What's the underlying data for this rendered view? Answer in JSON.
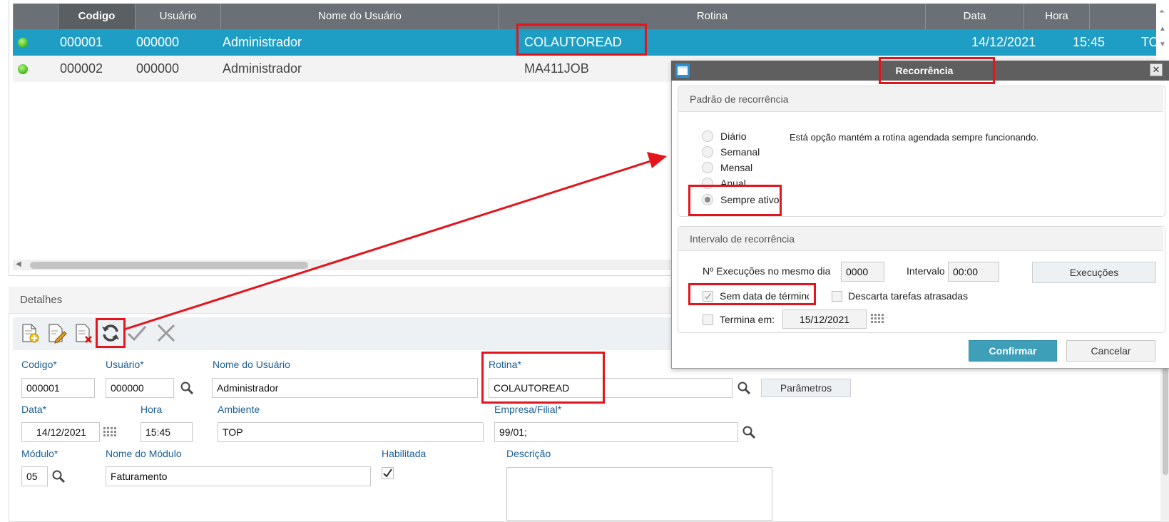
{
  "grid": {
    "columns": [
      "",
      "Codigo",
      "Usuário",
      "Nome do Usuário",
      "Rotina",
      "Data",
      "Hora",
      ""
    ],
    "rows": [
      {
        "codigo": "000001",
        "usuario": "000000",
        "nome": "Administrador",
        "rotina": "COLAUTOREAD",
        "data": "14/12/2021",
        "hora": "15:45",
        "extra": "TO"
      },
      {
        "codigo": "000002",
        "usuario": "000000",
        "nome": "Administrador",
        "rotina": "MA411JOB",
        "data": "",
        "hora": "",
        "extra": ""
      }
    ]
  },
  "details": {
    "title": "Detalhes",
    "toolbar_icons": [
      "add-document-icon",
      "edit-document-icon",
      "delete-document-icon",
      "refresh-icon",
      "confirm-check-icon",
      "cancel-x-icon"
    ],
    "labels": {
      "codigo": "Codigo*",
      "usuario": "Usuário*",
      "nome_usuario": "Nome do Usuário",
      "rotina": "Rotina*",
      "data": "Data*",
      "hora": "Hora",
      "ambiente": "Ambiente",
      "empresa": "Empresa/Filial*",
      "modulo": "Módulo*",
      "nome_modulo": "Nome do Módulo",
      "habilitada": "Habilitada",
      "descricao": "Descrição"
    },
    "values": {
      "codigo": "000001",
      "usuario": "000000",
      "nome_usuario": "Administrador",
      "rotina": "COLAUTOREAD",
      "data": "14/12/2021",
      "hora": "15:45",
      "ambiente": "TOP",
      "empresa": "99/01;",
      "modulo": "05",
      "nome_modulo": "Faturamento",
      "descricao": ""
    },
    "habilitada_checked": true,
    "parametros_button": "Parâmetros"
  },
  "dialog": {
    "title": "Recorrência",
    "pattern_title": "Padrão de recorrência",
    "options": [
      "Diário",
      "Semanal",
      "Mensal",
      "Anual",
      "Sempre ativo"
    ],
    "selected_option": "Sempre ativo",
    "description": "Está opção mantém a rotina agendada sempre funcionando.",
    "interval_title": "Intervalo de recorrência",
    "exec_label": "Nº Execuções no mesmo dia",
    "exec_value": "0000",
    "intervalo_label": "Intervalo",
    "intervalo_value": "00:00",
    "execucoes_button": "Execuções",
    "sem_data_label": "Sem data de términc",
    "sem_data_checked": true,
    "descarta_label": "Descarta tarefas atrasadas",
    "descarta_checked": false,
    "termina_label": "Termina em:",
    "termina_checked": false,
    "termina_value": "15/12/2021",
    "confirm_button": "Confirmar",
    "cancel_button": "Cancelar"
  },
  "colors": {
    "selected_row": "#1f9ec5",
    "header": "#6a7075",
    "label_blue": "#1c5f95",
    "confirm": "#3e9fb8",
    "highlight_red": "#e3141c"
  }
}
